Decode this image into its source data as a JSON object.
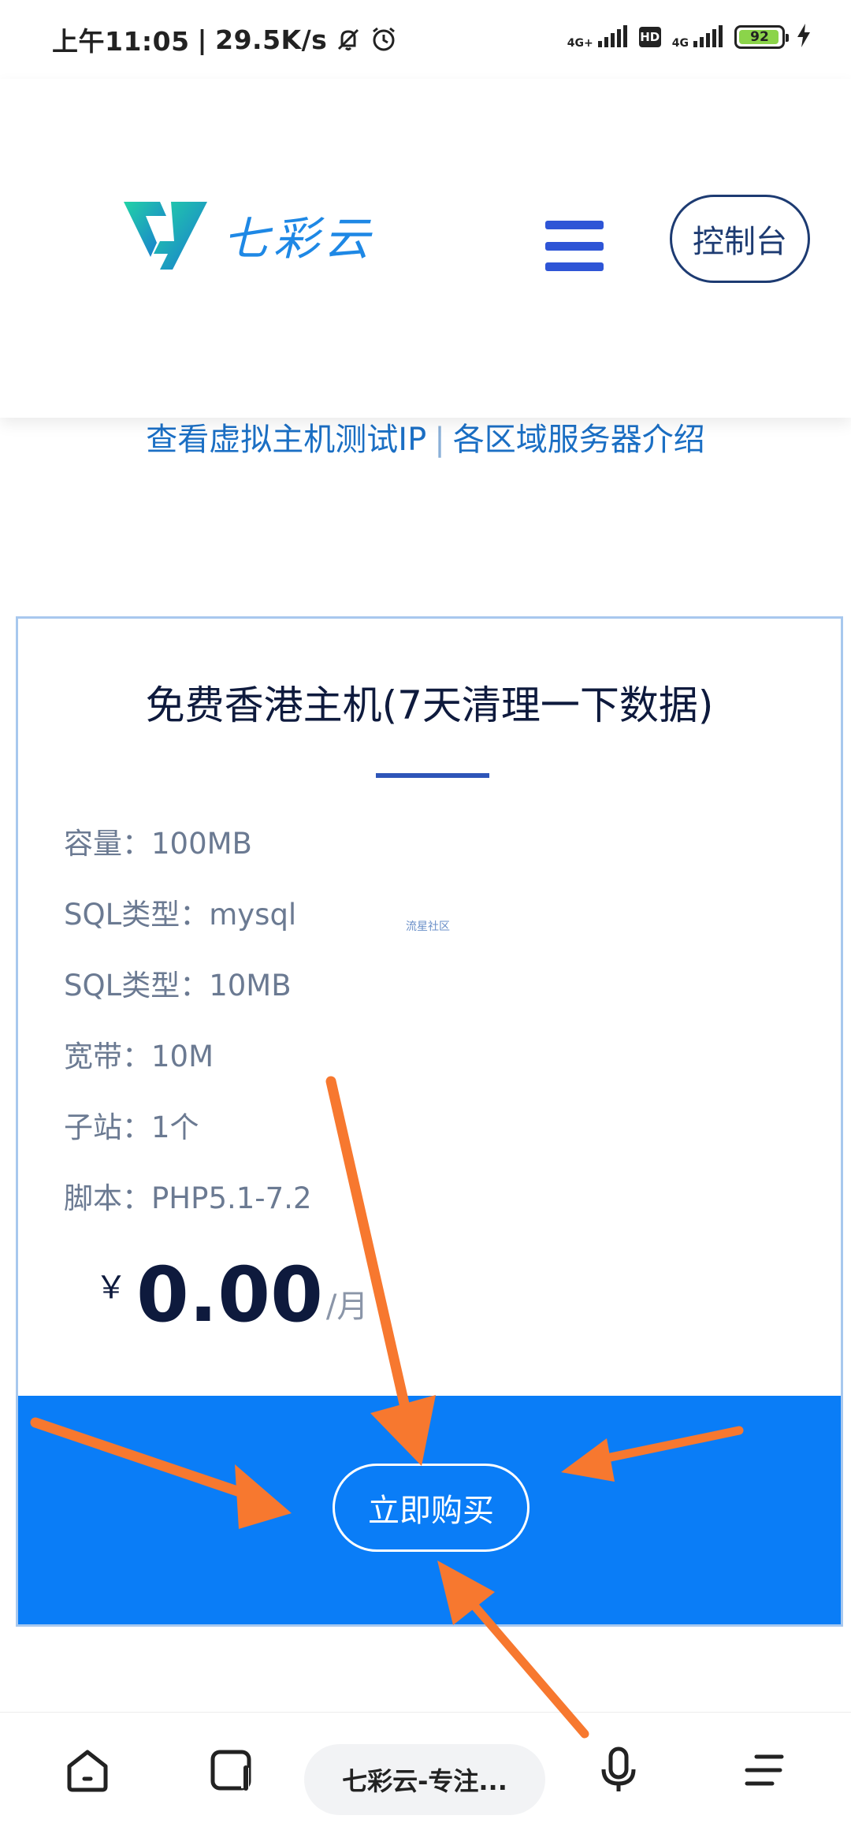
{
  "status_bar": {
    "time": "上午11:05",
    "separator": "|",
    "speed": "29.5K/s",
    "net1": "4G+",
    "hd": "HD",
    "net2": "4G",
    "battery": "92"
  },
  "header": {
    "logo_text": "七彩云",
    "console_label": "控制台"
  },
  "links": {
    "left": "查看虚拟主机测试IP",
    "sep": "|",
    "right": "各区域服务器介绍"
  },
  "card": {
    "title": "免费香港主机(7天清理一下数据)",
    "specs": [
      "容量：100MB",
      "SQL类型：mysql",
      "SQL类型：10MB",
      "宽带：10M",
      "子站：1个",
      "脚本：PHP5.1-7.2"
    ],
    "watermark": "流星社区",
    "currency": "￥",
    "price": "0.00",
    "per": "/月",
    "buy_label": "立即购买"
  },
  "bottom_bar": {
    "url_title": "七彩云-专注..."
  },
  "colors": {
    "accent_blue": "#0a7df7",
    "link_blue": "#1b6fc4",
    "navy": "#0e1a3d",
    "annotation_orange": "#f7782f",
    "battery_green": "#8bd44a"
  },
  "icons": [
    "mute-bell-icon",
    "alarm-icon",
    "signal-icon",
    "battery-icon",
    "charging-icon",
    "logo-icon",
    "hamburger-menu-icon",
    "home-icon",
    "tabs-icon",
    "microphone-icon",
    "browser-menu-icon"
  ]
}
